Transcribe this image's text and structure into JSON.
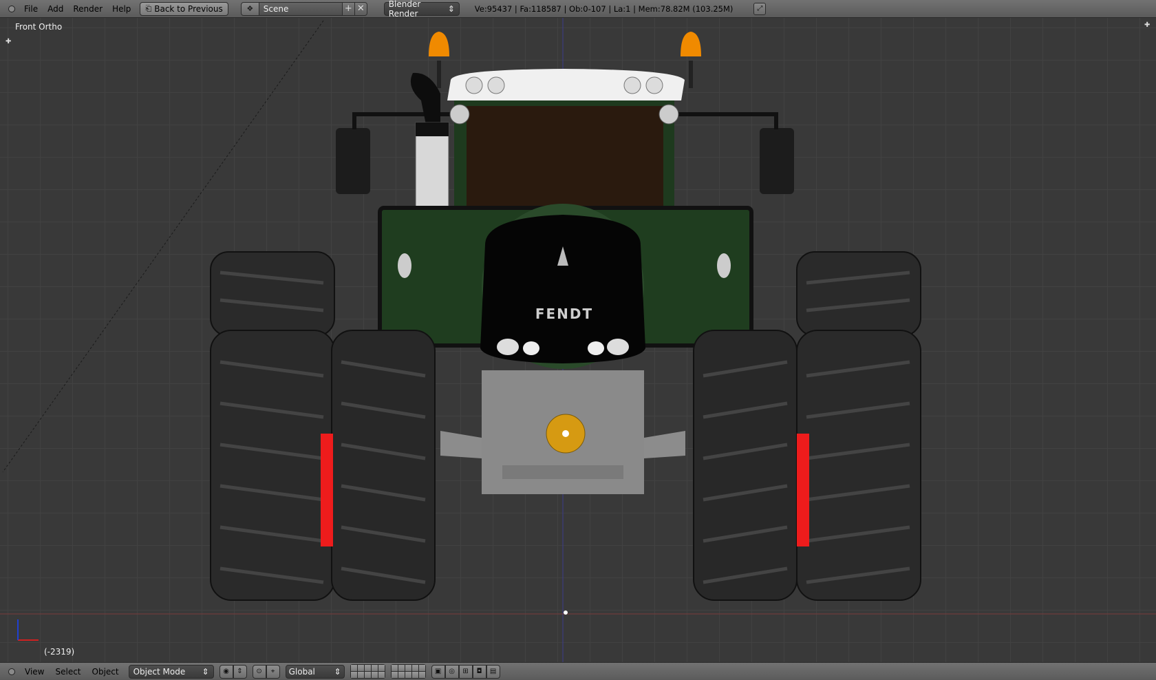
{
  "topbar": {
    "menus": [
      "File",
      "Add",
      "Render",
      "Help"
    ],
    "back_button": "Back to Previous",
    "scene_name": "Scene",
    "render_engine": "Blender Render",
    "stats": "Ve:95437 | Fa:118587 | Ob:0-107 | La:1 | Mem:78.82M (103.25M)"
  },
  "viewport": {
    "view_name": "Front Ortho",
    "frame_info": "(-2319)",
    "model_brand": "FENDT"
  },
  "bottombar": {
    "menus": [
      "View",
      "Select",
      "Object"
    ],
    "mode": "Object Mode",
    "orientation": "Global"
  },
  "colors": {
    "tractor_green": "#1f3d1f",
    "beacon_orange": "#f08a00",
    "reflector_red": "#ee1c1c",
    "tire": "#2a2a2a",
    "hitch_grey": "#8c8c8c",
    "hub_yellow": "#d69a12"
  }
}
